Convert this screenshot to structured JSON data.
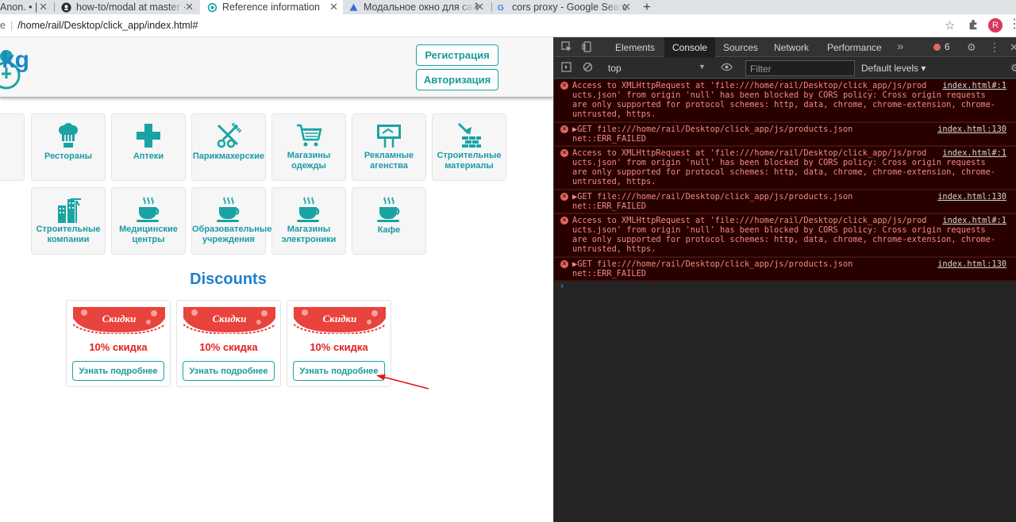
{
  "browser": {
    "tabs": [
      {
        "title": "Anon. • |",
        "active": false
      },
      {
        "title": "how-to/modal at master ·",
        "active": false
      },
      {
        "title": "Reference information",
        "active": true
      },
      {
        "title": "Модальное окно для сай",
        "active": false
      },
      {
        "title": "cors proxy - Google Searc",
        "active": false
      }
    ],
    "new_tab": "+",
    "address_prefix": "e",
    "address": "/home/rail/Desktop/click_app/index.html#",
    "profile_initial": "R"
  },
  "site": {
    "logo_text": "kg",
    "register_label": "Регистрация",
    "login_label": "Авторизация",
    "categories": [
      {
        "label": "Рестораны",
        "icon": "chef-hat-icon"
      },
      {
        "label": "Аптеки",
        "icon": "pharmacy-cross-icon"
      },
      {
        "label": "Парикмахерские",
        "icon": "scissors-comb-icon"
      },
      {
        "label": "Магазины одежды",
        "icon": "shopping-cart-icon"
      },
      {
        "label": "Рекламные агенства",
        "icon": "billboard-icon"
      },
      {
        "label": "Строительные материалы",
        "icon": "bricks-trowel-icon"
      },
      {
        "label": "Строительные компании",
        "icon": "buildings-crane-icon"
      },
      {
        "label": "Медицинские центры",
        "icon": "coffee-cup-icon"
      },
      {
        "label": "Образовательные учреждения",
        "icon": "coffee-cup-icon"
      },
      {
        "label": "Магазины электроники",
        "icon": "coffee-cup-icon"
      },
      {
        "label": "Кафе",
        "icon": "coffee-cup-icon"
      }
    ],
    "discounts_title": "Discounts",
    "discounts": [
      {
        "banner": "Скидки",
        "percent": "10% скидка",
        "button": "Узнать подробнее"
      },
      {
        "banner": "Скидки",
        "percent": "10% скидка",
        "button": "Узнать подробнее"
      },
      {
        "banner": "Скидки",
        "percent": "10% скидка",
        "button": "Узнать подробнее"
      }
    ]
  },
  "devtools": {
    "tabs": [
      "Elements",
      "Console",
      "Sources",
      "Network",
      "Performance"
    ],
    "active_tab": "Console",
    "more": "»",
    "error_count": "6",
    "context": "top",
    "filter_placeholder": "Filter",
    "levels": "Default levels ▾",
    "messages": [
      {
        "type": "cors",
        "lines": [
          "Access to XMLHttpRequest at 'file:///home/rail/Desktop/click_app/js/prod",
          "ucts.json' from origin 'null' has been blocked by CORS policy: Cross origin requests",
          "are only supported for protocol schemes: http, data, chrome, chrome-extension, chrome-",
          "untrusted, https."
        ],
        "source": "index.html#:1"
      },
      {
        "type": "get",
        "lines": [
          "▶GET file:///home/rail/Desktop/click_app/js/products.json",
          "net::ERR_FAILED"
        ],
        "source": "index.html:130"
      },
      {
        "type": "cors",
        "lines": [
          "Access to XMLHttpRequest at 'file:///home/rail/Desktop/click_app/js/prod",
          "ucts.json' from origin 'null' has been blocked by CORS policy: Cross origin requests",
          "are only supported for protocol schemes: http, data, chrome, chrome-extension, chrome-",
          "untrusted, https."
        ],
        "source": "index.html#:1"
      },
      {
        "type": "get",
        "lines": [
          "▶GET file:///home/rail/Desktop/click_app/js/products.json",
          "net::ERR_FAILED"
        ],
        "source": "index.html:130"
      },
      {
        "type": "cors",
        "lines": [
          "Access to XMLHttpRequest at 'file:///home/rail/Desktop/click_app/js/prod",
          "ucts.json' from origin 'null' has been blocked by CORS policy: Cross origin requests",
          "are only supported for protocol schemes: http, data, chrome, chrome-extension, chrome-",
          "untrusted, https."
        ],
        "source": "index.html#:1"
      },
      {
        "type": "get",
        "lines": [
          "▶GET file:///home/rail/Desktop/click_app/js/products.json",
          "net::ERR_FAILED"
        ],
        "source": "index.html:130"
      }
    ],
    "prompt": "›"
  }
}
